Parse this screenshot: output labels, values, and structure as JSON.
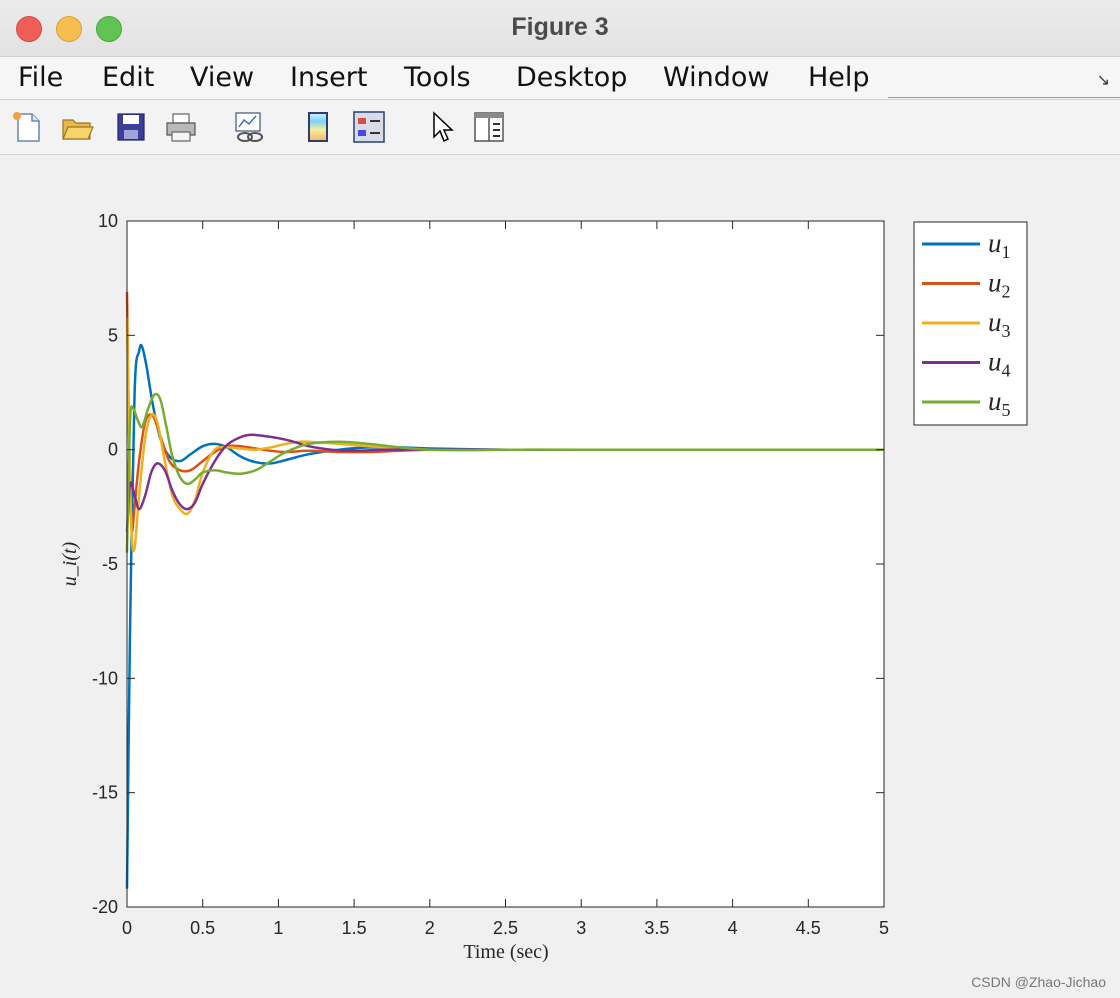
{
  "window": {
    "title": "Figure 3",
    "watermark": "CSDN @Zhao-Jichao"
  },
  "menu": {
    "items": [
      "File",
      "Edit",
      "View",
      "Insert",
      "Tools",
      "Desktop",
      "Window",
      "Help"
    ]
  },
  "toolbar": {
    "icons": [
      "new-file-icon",
      "open-folder-icon",
      "save-icon",
      "print-icon",
      "link-plot-icon",
      "colorbar-icon",
      "legend-icon",
      "pointer-icon",
      "property-editor-icon"
    ]
  },
  "chart_data": {
    "type": "line",
    "xlabel": "Time (sec)",
    "ylabel": "u_i(t)",
    "xlim": [
      0,
      5
    ],
    "ylim": [
      -20,
      10
    ],
    "xticks": [
      "0",
      "0.5",
      "1",
      "1.5",
      "2",
      "2.5",
      "3",
      "3.5",
      "4",
      "4.5",
      "5"
    ],
    "yticks": [
      "10",
      "5",
      "0",
      "-5",
      "-10",
      "-15",
      "-20"
    ],
    "grid": false,
    "legend_position": "outside-top-right",
    "series": [
      {
        "name": "u",
        "subscript": "1",
        "color": "#0072BD",
        "x": [
          0,
          0.02,
          0.05,
          0.08,
          0.1,
          0.13,
          0.17,
          0.22,
          0.28,
          0.35,
          0.42,
          0.5,
          0.58,
          0.66,
          0.75,
          0.85,
          0.95,
          1.05,
          1.2,
          1.4,
          1.6,
          1.8,
          2.0,
          2.5,
          3,
          4,
          5
        ],
        "y": [
          -19.2,
          -8,
          2.5,
          4.3,
          4.5,
          3.6,
          2.0,
          0.5,
          -0.3,
          -0.5,
          -0.2,
          0.15,
          0.25,
          0.1,
          -0.3,
          -0.55,
          -0.6,
          -0.45,
          -0.2,
          0.0,
          0.1,
          0.1,
          0.05,
          0.0,
          0.0,
          0.0,
          0.0
        ]
      },
      {
        "name": "u",
        "subscript": "2",
        "color": "#D95319",
        "x": [
          0,
          0.015,
          0.03,
          0.05,
          0.08,
          0.12,
          0.17,
          0.22,
          0.28,
          0.35,
          0.42,
          0.5,
          0.58,
          0.66,
          0.75,
          0.85,
          0.95,
          1.05,
          1.2,
          1.4,
          1.6,
          1.8,
          2.0,
          2.5,
          3,
          4,
          5
        ],
        "y": [
          6.9,
          0,
          -3.5,
          -2.5,
          -0.5,
          1.2,
          1.5,
          0.6,
          -0.5,
          -0.9,
          -0.9,
          -0.5,
          -0.1,
          0.15,
          0.15,
          0.05,
          -0.05,
          -0.1,
          -0.05,
          -0.1,
          -0.1,
          -0.05,
          0.0,
          0.0,
          0.0,
          0.0,
          0.0
        ]
      },
      {
        "name": "u",
        "subscript": "3",
        "color": "#EDB120",
        "x": [
          0,
          0.01,
          0.03,
          0.05,
          0.08,
          0.12,
          0.16,
          0.2,
          0.25,
          0.3,
          0.35,
          0.4,
          0.45,
          0.5,
          0.58,
          0.66,
          0.75,
          0.85,
          0.95,
          1.05,
          1.15,
          1.3,
          1.5,
          1.7,
          2.0,
          2.5,
          3,
          4,
          5
        ],
        "y": [
          5.8,
          2.0,
          -3.5,
          -4.3,
          -2.0,
          0.5,
          1.5,
          1.2,
          -0.5,
          -2.0,
          -2.6,
          -2.8,
          -2.2,
          -1.0,
          0.0,
          0.1,
          0.05,
          0.0,
          0.1,
          0.25,
          0.35,
          0.3,
          0.2,
          0.1,
          0.0,
          0.0,
          0.0,
          0.0,
          0.0
        ]
      },
      {
        "name": "u",
        "subscript": "4",
        "color": "#7E2F8E",
        "x": [
          0,
          0.02,
          0.05,
          0.08,
          0.12,
          0.16,
          0.2,
          0.25,
          0.3,
          0.35,
          0.4,
          0.45,
          0.5,
          0.58,
          0.66,
          0.75,
          0.82,
          0.9,
          1.0,
          1.1,
          1.2,
          1.35,
          1.5,
          1.7,
          2.0,
          2.5,
          3,
          4,
          5
        ],
        "y": [
          -3.6,
          -1.5,
          -2.0,
          -2.6,
          -2.0,
          -1.0,
          -0.6,
          -0.9,
          -1.8,
          -2.4,
          -2.6,
          -2.3,
          -1.5,
          -0.5,
          0.2,
          0.55,
          0.65,
          0.6,
          0.5,
          0.35,
          0.15,
          0.0,
          -0.05,
          0.0,
          0.0,
          0.0,
          0.0,
          0.0,
          0.0
        ]
      },
      {
        "name": "u",
        "subscript": "5",
        "color": "#77AC30",
        "x": [
          0,
          0.02,
          0.04,
          0.07,
          0.1,
          0.14,
          0.18,
          0.22,
          0.26,
          0.3,
          0.35,
          0.4,
          0.45,
          0.5,
          0.58,
          0.66,
          0.75,
          0.85,
          0.95,
          1.05,
          1.2,
          1.4,
          1.6,
          1.8,
          2.0,
          2.3,
          2.6,
          3,
          4,
          5
        ],
        "y": [
          -4.5,
          1.2,
          1.8,
          1.3,
          1.0,
          1.8,
          2.4,
          2.2,
          1.0,
          -0.3,
          -1.2,
          -1.5,
          -1.3,
          -1.0,
          -0.9,
          -1.0,
          -1.05,
          -0.9,
          -0.5,
          -0.1,
          0.25,
          0.35,
          0.25,
          0.1,
          0.0,
          -0.02,
          0.0,
          0.0,
          0.0,
          0.0
        ]
      }
    ]
  }
}
